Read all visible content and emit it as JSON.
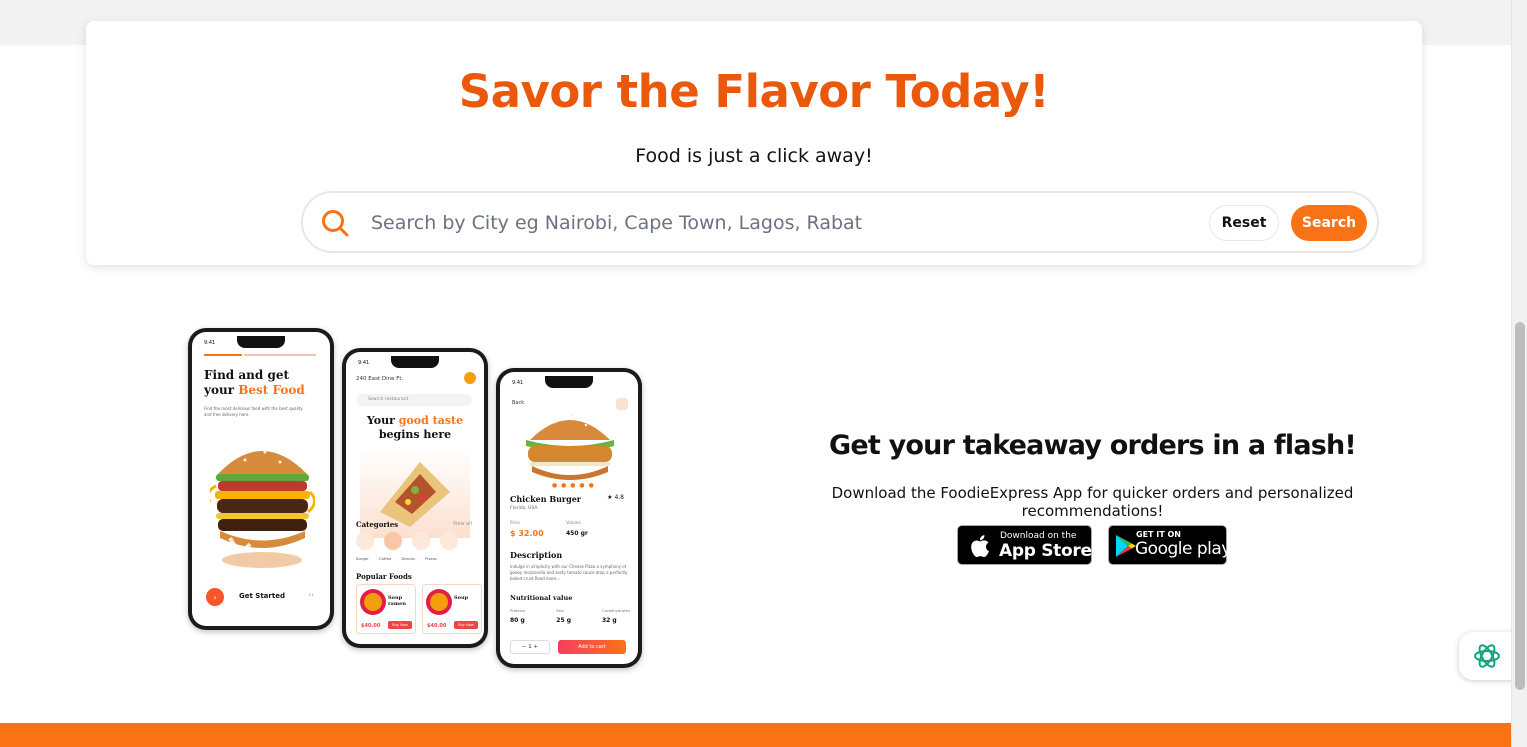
{
  "hero": {
    "title": "Savor the Flavor Today!",
    "subtitle": "Food is just a click away!",
    "search_placeholder": "Search by City eg Nairobi, Cape Town, Lagos, Rabat",
    "reset_label": "Reset",
    "search_label": "Search"
  },
  "phones": {
    "time": "9:41",
    "screen1": {
      "headline_line1": "Find and get",
      "headline_prefix": "your ",
      "headline_accent": "Best Food",
      "subtext": "Find the most delicious food with the best quality and free delivery here.",
      "cta": "Get Started"
    },
    "screen2": {
      "location": "240 East Dine Ft.",
      "search": "Search restaurant",
      "headline_prefix": "Your ",
      "headline_accent": "good taste",
      "headline_line2": "begins here",
      "categories_title": "Categories",
      "view_all": "View all",
      "category_labels": "Burger Coffee Donuts Pizzas",
      "popular_title": "Popular Foods",
      "card1_name": "Soup ramen",
      "card1_price": "$40.00",
      "card2_name": "Soup",
      "card2_price": "$40.00",
      "buy_now": "Buy Now"
    },
    "screen3": {
      "back": "Back",
      "name": "Chicken Burger",
      "rating": "★ 4.8",
      "location": "Florida, USA",
      "price_label": "Price",
      "price": "$ 32.00",
      "volume_label": "Volume",
      "volume": "450 gr",
      "description_title": "Description",
      "description": "Indulge in simplicity with our Cheese Pizza a symphony of gooey mozzarella and zesty tomato sauce atop a perfectly baked crust Read more...",
      "nutrition_title": "Nutritional value",
      "protein_label": "Proteins",
      "protein": "80 g",
      "fats_label": "Fats",
      "fats": "25 g",
      "carbs_label": "Carbohydrates",
      "carbs": "32 g",
      "qty": "−  1  +",
      "add_to_cart": "Add to cart"
    }
  },
  "promo": {
    "title": "Get your takeaway orders in a flash!",
    "text": "Download the FoodieExpress App for quicker orders and personalized recommendations!",
    "appstore_line1": "Download on the",
    "appstore_line2": "App Store",
    "googleplay_line1": "GET IT ON",
    "googleplay_line2": "Google play"
  },
  "colors": {
    "accent": "#ea580c",
    "button": "#f97316",
    "footer": "#f97316"
  },
  "icons": {
    "search": "search-icon",
    "apple": "apple-icon",
    "google_play": "google-play-icon",
    "chat": "chat-assistant-icon"
  }
}
